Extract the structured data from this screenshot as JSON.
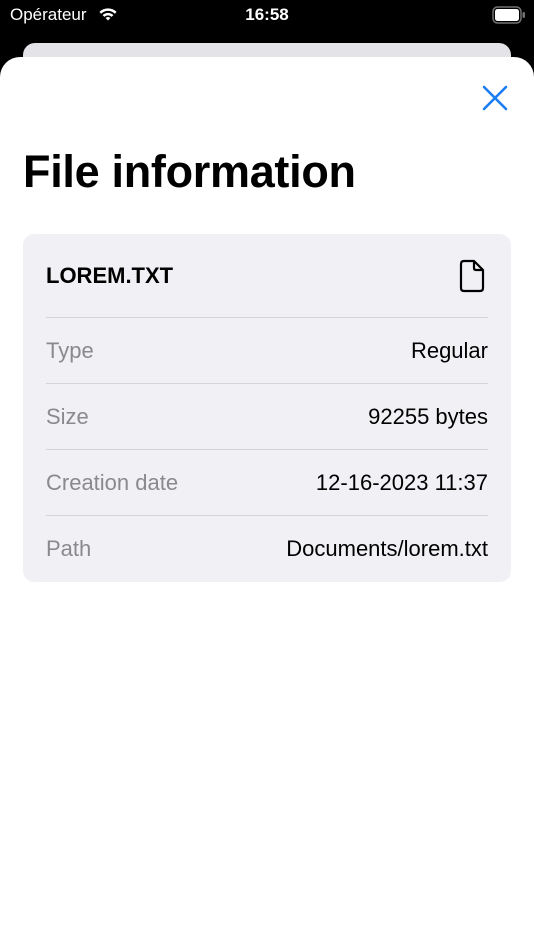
{
  "status_bar": {
    "carrier": "Opérateur",
    "time": "16:58"
  },
  "sheet": {
    "close_icon": "close-x-icon",
    "title": "File information",
    "accent_color": "#1a7cf2"
  },
  "file": {
    "name": "LOREM.TXT",
    "icon": "document-icon",
    "rows": [
      {
        "label": "Type",
        "value": "Regular"
      },
      {
        "label": "Size",
        "value": "92255 bytes"
      },
      {
        "label": "Creation date",
        "value": "12-16-2023 11:37"
      },
      {
        "label": "Path",
        "value": "Documents/lorem.txt"
      }
    ]
  }
}
